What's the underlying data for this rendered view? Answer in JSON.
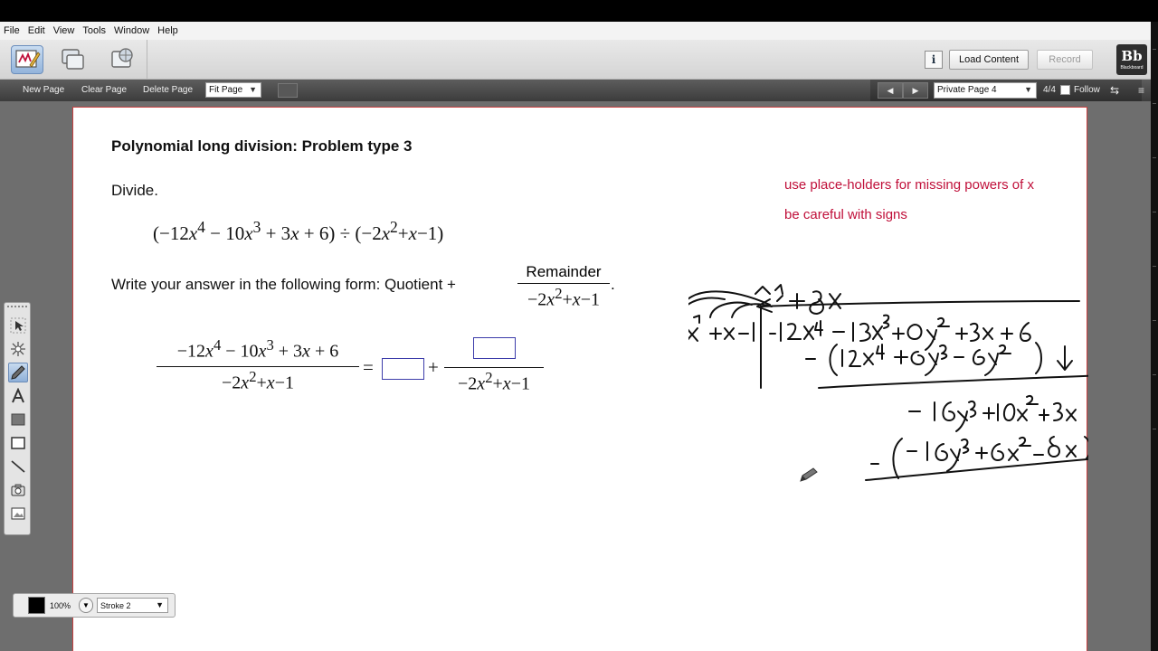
{
  "menu": [
    "File",
    "Edit",
    "View",
    "Tools",
    "Window",
    "Help"
  ],
  "toolbar": {
    "load_content_label": "Load Content",
    "record_label": "Record",
    "info_label": "i",
    "logo_text": "Bb",
    "logo_sub": "Blackboard"
  },
  "pagebar": {
    "new_page": "New Page",
    "clear_page": "Clear Page",
    "delete_page": "Delete Page",
    "fit_page": "Fit Page",
    "page_select": "Private Page 4",
    "page_count": "4/4",
    "follow_label": "Follow"
  },
  "content": {
    "title": "Polynomial long division: Problem type 3",
    "divide_label": "Divide.",
    "instruction": "Write your answer in the following form: Quotient +",
    "remainder_word": "Remainder",
    "annotation_1": "use place-holders for missing powers of x",
    "annotation_2": "be careful with signs"
  },
  "properties": {
    "opacity": "100%",
    "stroke": "Stroke 2",
    "ink_color": "#000000"
  },
  "colors": {
    "annotation": "#c0103a",
    "page_border": "#c94040",
    "answer_box_border": "#3c3caa"
  }
}
